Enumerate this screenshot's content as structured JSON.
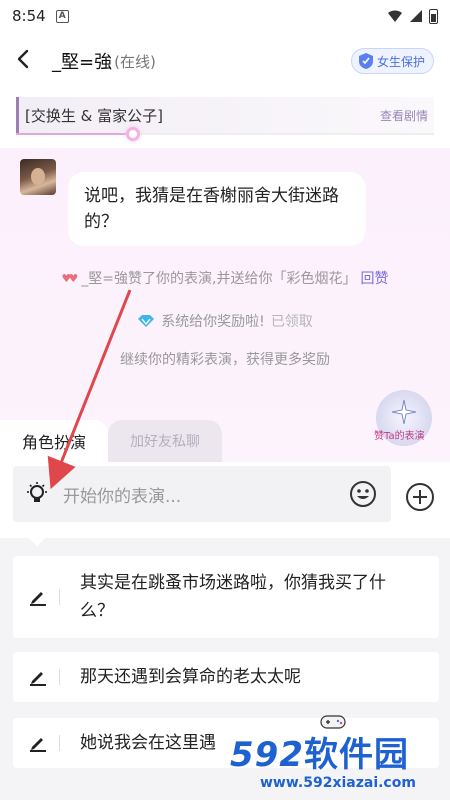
{
  "status_bar": {
    "time": "8:54",
    "app_badge": "A"
  },
  "header": {
    "back_icon": "chevron-left-icon",
    "title": "_堅=強",
    "online_status": "(在线)",
    "protect_label": "女生保护"
  },
  "scene": {
    "title": "[交换生 & 富家公子]",
    "view_plot_label": "查看剧情",
    "progress": 0.28
  },
  "chat": {
    "message": "说吧，我猜是在香榭丽舍大街迷路的？",
    "like_notice": "_堅=強赞了你的表演,并送给你「彩色烟花」",
    "like_back_label": "回赞",
    "reward_notice": "系统给你奖励啦!",
    "reward_status": "已领取",
    "encourage_notice": "继续你的精彩表演，获得更多奖励",
    "applause_label": "赞Ta的表演"
  },
  "tabs": {
    "roleplay": "角色扮演",
    "private_chat": "加好友私聊"
  },
  "input": {
    "placeholder": "开始你的表演..."
  },
  "suggestions": [
    "其实是在跳蚤市场迷路啦，你猜我买了什么？",
    "那天还遇到会算命的老太太呢",
    "她说我会在这里遇"
  ],
  "watermark": {
    "brand_num": "592",
    "brand_text": "软件园",
    "url": "www.592xiazai.com"
  },
  "colors": {
    "accent": "#7c6cd6",
    "chat_bg": "#fbf0fb",
    "arrow": "#e0474c",
    "watermark": "#1e62d2"
  }
}
